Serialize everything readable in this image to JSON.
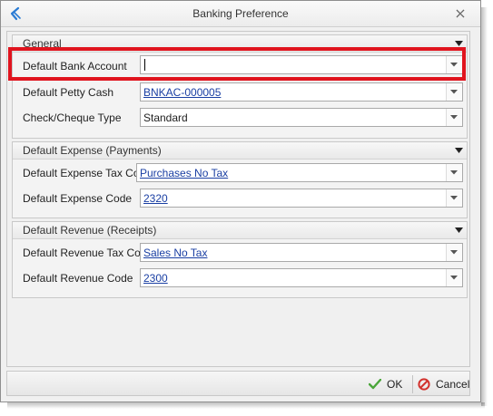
{
  "window": {
    "title": "Banking Preference"
  },
  "groups": [
    {
      "title": "General",
      "fields": [
        {
          "label": "Default Bank Account",
          "value": "",
          "is_link": false
        },
        {
          "label": "Default Petty Cash",
          "value": "BNKAC-000005",
          "is_link": true
        },
        {
          "label": "Check/Cheque Type",
          "value": "Standard",
          "is_link": false
        }
      ]
    },
    {
      "title": "Default Expense (Payments)",
      "fields": [
        {
          "label": "Default Expense Tax Code",
          "value": "Purchases No Tax",
          "is_link": true
        },
        {
          "label": "Default Expense Code",
          "value": "2320",
          "is_link": true
        }
      ]
    },
    {
      "title": "Default Revenue (Receipts)",
      "fields": [
        {
          "label": "Default Revenue Tax Code",
          "value": "Sales No Tax",
          "is_link": true
        },
        {
          "label": "Default Revenue Code",
          "value": "2300",
          "is_link": true
        }
      ]
    }
  ],
  "footer": {
    "ok_label": "OK",
    "cancel_label": "Cancel"
  },
  "colors": {
    "highlight": "#e0141e",
    "link": "#1a3fa3",
    "ok_check": "#4aa63a",
    "cancel_icon": "#d2322d"
  },
  "icons": [
    "app-logo-icon",
    "close-icon",
    "collapse-arrow-icon",
    "dropdown-arrow-icon",
    "checkmark-icon",
    "cancel-circle-icon"
  ]
}
